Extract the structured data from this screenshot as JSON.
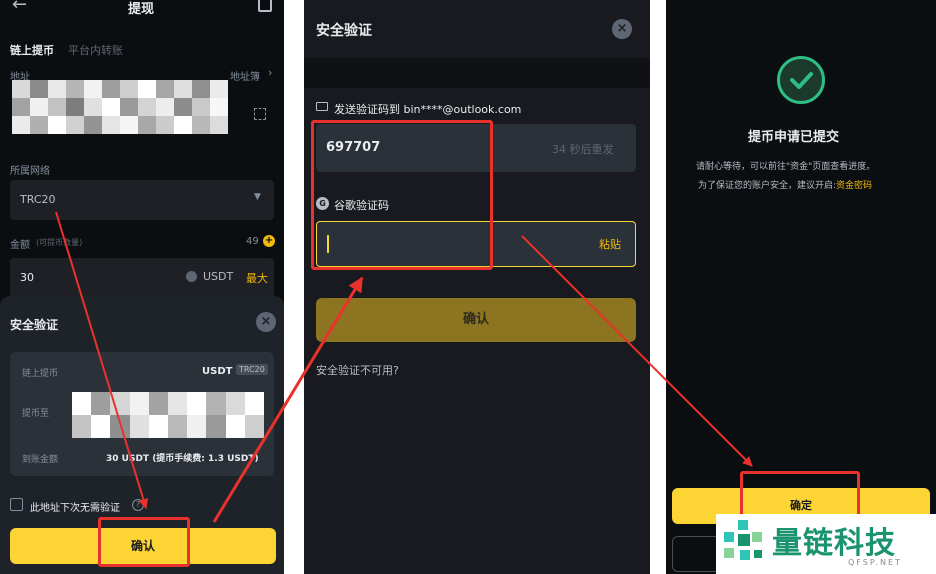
{
  "panel1": {
    "header_title": "提现",
    "tab_onchain": "链上提币",
    "tab_internal": "平台内转账",
    "address_label": "地址",
    "address_book": "地址簿",
    "network_label": "所属网络",
    "network_value": "TRC20",
    "amount_label": "金额",
    "amount_hint": "(可提币数量)",
    "amount_available": "49",
    "amount_value": "30",
    "currency": "USDT",
    "max_label": "最大",
    "modal": {
      "title": "安全验证",
      "row1_label": "链上提币",
      "row1_value": "USDT",
      "row1_badge": "TRC20",
      "row2_label": "提币至",
      "row3_label": "到账金额",
      "row3_value": "30 USDT (提币手续费: 1.3 USDT)",
      "checkbox_label": "此地址下次无需验证",
      "confirm_label": "确认"
    }
  },
  "panel2": {
    "title": "安全验证",
    "email_label": "发送验证码到 bin****@outlook.com",
    "email_code": "697707",
    "resend": "34 秒后重发",
    "google_label": "谷歌验证码",
    "paste": "粘贴",
    "confirm_label": "确认",
    "unavailable": "安全验证不可用?"
  },
  "panel3": {
    "title": "提币申请已提交",
    "line1": "请耐心等待，可以前往\"资金\"页面查看进度。",
    "line2_prefix": "为了保证您的账户安全，建议开启:",
    "line2_link": "资金密码",
    "confirm_label": "确定"
  },
  "watermark": {
    "brand": "量链科技",
    "domain": "QFSP.NET"
  },
  "colors": {
    "accent": "#fcd535",
    "arrow": "#e8322b",
    "success": "#2ebd85",
    "background": "#0b0e11"
  }
}
